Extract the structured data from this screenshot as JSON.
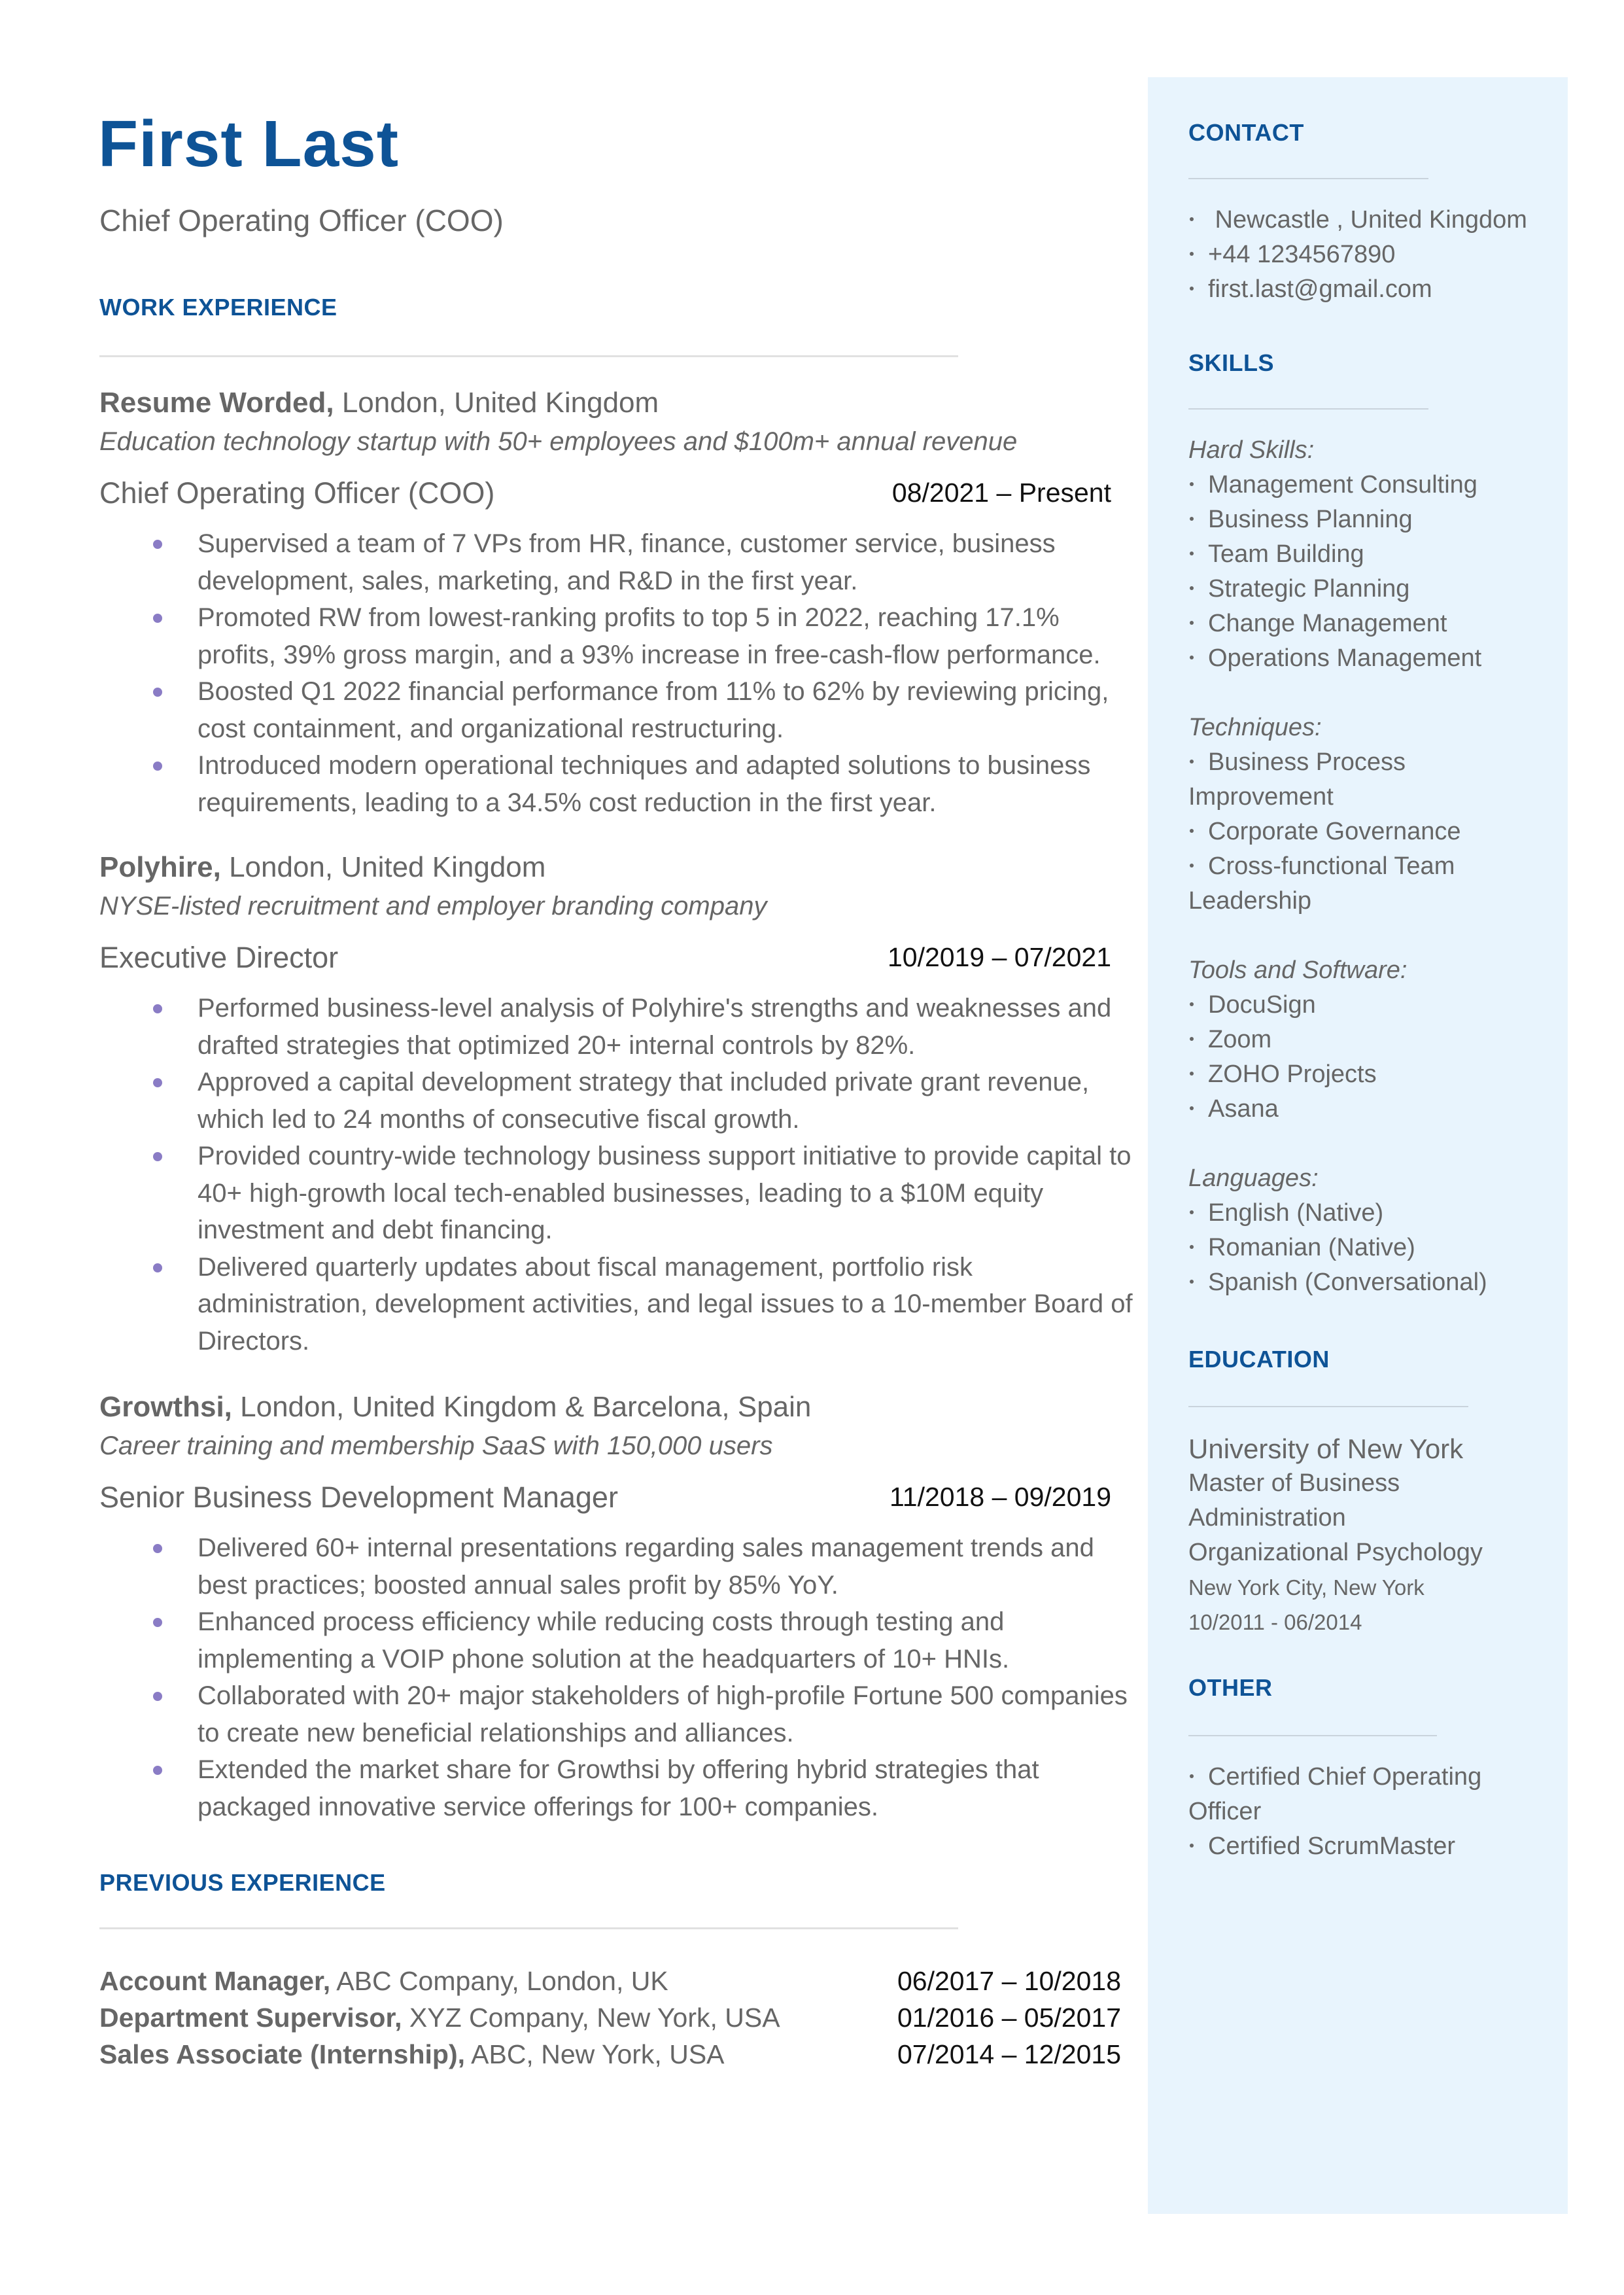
{
  "header": {
    "name": "First Last",
    "title": "Chief Operating Officer (COO)"
  },
  "colors": {
    "accent": "#0e5396",
    "bullet": "#8a7cc5",
    "sidebar_bg": "#e8f4fd",
    "text": "#666666",
    "divider": "#e1e1e1"
  },
  "work_experience": {
    "heading": "WORK EXPERIENCE",
    "jobs": [
      {
        "company": "Resume Worded,",
        "location": " London, United Kingdom",
        "description": "Education technology startup with 50+ employees and $100m+ annual revenue",
        "role": "Chief Operating Officer (COO)",
        "dates": "08/2021 – Present",
        "bullets": [
          "Supervised a team of 7 VPs from HR, finance, customer service, business development, sales, marketing, and R&D in the first year.",
          "Promoted RW from lowest-ranking profits to top 5 in 2022, reaching 17.1% profits, 39% gross margin, and a 93% increase in free-cash-flow performance.",
          "Boosted Q1 2022 financial performance from 11% to 62% by reviewing pricing, cost containment, and organizational restructuring.",
          "Introduced modern operational techniques and adapted solutions to business requirements, leading to a 34.5% cost reduction in the first year."
        ]
      },
      {
        "company": "Polyhire,",
        "location": " London, United Kingdom",
        "description": "NYSE-listed recruitment and employer branding company",
        "role": "Executive Director",
        "dates": "10/2019 – 07/2021",
        "bullets": [
          "Performed business-level analysis of Polyhire's strengths and weaknesses and drafted strategies that optimized 20+ internal controls by 82%.",
          "Approved a capital development strategy that included private grant revenue, which led to 24 months of consecutive fiscal growth.",
          "Provided country-wide technology business support initiative to provide capital to 40+ high-growth local tech-enabled businesses, leading to a $10M equity investment and debt financing.",
          "Delivered quarterly updates about fiscal management, portfolio risk administration, development activities, and legal issues to a 10-member Board of Directors."
        ]
      },
      {
        "company": "Growthsi,",
        "location": " London, United Kingdom & Barcelona, Spain",
        "description": "Career training and membership SaaS with 150,000 users",
        "role": "Senior Business Development Manager",
        "dates": "11/2018 – 09/2019",
        "bullets": [
          "Delivered 60+ internal presentations regarding sales management trends and best practices; boosted annual sales profit by 85% YoY.",
          "Enhanced process efficiency while reducing costs through testing and implementing a VOIP phone solution at the headquarters of 10+ HNIs.",
          "Collaborated with 20+ major stakeholders of high-profile Fortune 500 companies to create new beneficial relationships and alliances.",
          "Extended the market share for Growthsi by offering hybrid strategies that packaged innovative service offerings for 100+ companies."
        ]
      }
    ]
  },
  "previous_experience": {
    "heading": "PREVIOUS EXPERIENCE",
    "items": [
      {
        "role": "Account Manager,",
        "detail": " ABC Company, London, UK",
        "dates": "06/2017 – 10/2018"
      },
      {
        "role": "Department Supervisor,",
        "detail": " XYZ Company, New York, USA",
        "dates": "01/2016 – 05/2017"
      },
      {
        "role": "Sales Associate (Internship),",
        "detail": " ABC, New York, USA",
        "dates": "07/2014 – 12/2015"
      }
    ]
  },
  "sidebar": {
    "contact": {
      "heading": "CONTACT",
      "items": [
        " Newcastle , United Kingdom",
        "+44 1234567890",
        "first.last@gmail.com"
      ]
    },
    "skills": {
      "heading": "SKILLS",
      "groups": [
        {
          "label": "Hard Skills:",
          "items": [
            "Management Consulting",
            "Business Planning",
            "Team Building",
            "Strategic Planning",
            "Change Management",
            "Operations Management"
          ]
        },
        {
          "label": "Techniques:",
          "items": [
            "Business Process Improvement",
            "Corporate Governance",
            "Cross-functional Team Leadership"
          ]
        },
        {
          "label": "Tools and Software:",
          "items": [
            "DocuSign",
            "Zoom",
            "ZOHO Projects",
            "Asana"
          ]
        },
        {
          "label": "Languages:",
          "items": [
            "English (Native)",
            "Romanian (Native)",
            "Spanish (Conversational)"
          ]
        }
      ]
    },
    "education": {
      "heading": "EDUCATION",
      "school": "University of New York",
      "degree": "Master of Business Administration",
      "field": "Organizational Psychology",
      "location": "New York City, New York",
      "dates": "10/2011 - 06/2014"
    },
    "other": {
      "heading": "OTHER",
      "items": [
        "Certified Chief Operating Officer",
        "Certified ScrumMaster"
      ]
    }
  }
}
